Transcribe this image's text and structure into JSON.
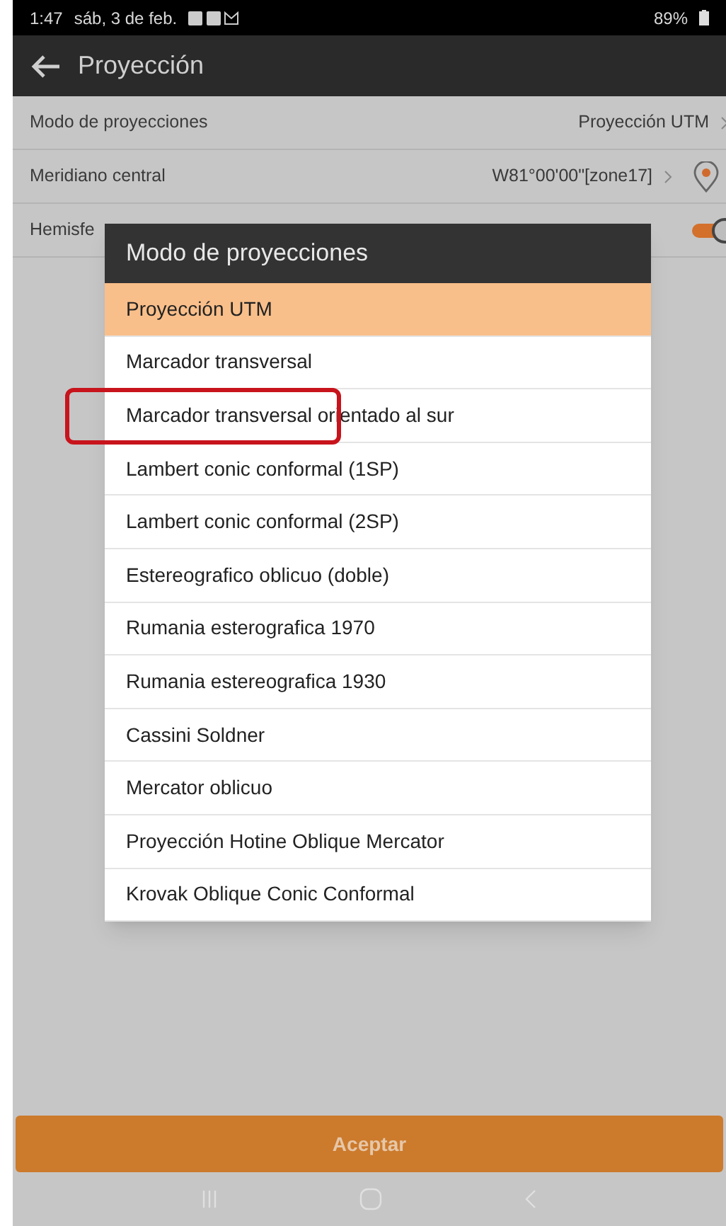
{
  "status_bar": {
    "time": "1:47",
    "date": "sáb, 3 de feb.",
    "battery": "89%"
  },
  "toolbar": {
    "title": "Proyección"
  },
  "settings": [
    {
      "kind": "value",
      "label": "Modo de proyecciones",
      "value": "Proyección UTM"
    },
    {
      "kind": "location",
      "label": "Meridiano central",
      "value": "W81°00'00\"[zone17]"
    },
    {
      "kind": "toggle",
      "label": "Hemisfe",
      "on": true
    }
  ],
  "dialog": {
    "title": "Modo de proyecciones",
    "items": [
      {
        "label": "Proyección UTM",
        "selected": true,
        "circled": false
      },
      {
        "label": "Marcador transversal",
        "selected": false,
        "circled": false
      },
      {
        "label": "Marcador transversal orientado al sur",
        "selected": false,
        "circled": true
      },
      {
        "label": "Lambert conic conformal (1SP)",
        "selected": false,
        "circled": false
      },
      {
        "label": "Lambert conic conformal (2SP)",
        "selected": false,
        "circled": false
      },
      {
        "label": "Estereografico oblicuo (doble)",
        "selected": false,
        "circled": false
      },
      {
        "label": "Rumania esterografica 1970",
        "selected": false,
        "circled": false
      },
      {
        "label": "Rumania estereografica 1930",
        "selected": false,
        "circled": false
      },
      {
        "label": "Cassini Soldner",
        "selected": false,
        "circled": false
      },
      {
        "label": "Mercator oblicuo",
        "selected": false,
        "circled": false
      },
      {
        "label": "Proyección Hotine Oblique Mercator",
        "selected": false,
        "circled": false
      },
      {
        "label": "Krovak Oblique Conic Conformal",
        "selected": false,
        "circled": false
      }
    ]
  },
  "accept_button": "Aceptar"
}
